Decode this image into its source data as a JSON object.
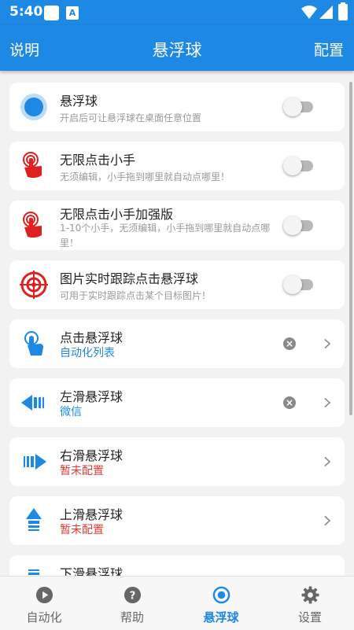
{
  "status_bar": {
    "time": "5:40",
    "a_icon_letter": "A"
  },
  "app_bar": {
    "left_label": "说明",
    "title": "悬浮球",
    "right_label": "配置"
  },
  "toggle_items": [
    {
      "title": "悬浮球",
      "subtitle": "开启后可让悬浮球在桌面任意位置",
      "icon": "floating-ball-icon",
      "enabled": false
    },
    {
      "title": "无限点击小手",
      "subtitle": "无须编辑，小手拖到哪里就自动点哪里！",
      "icon": "tap-hand-icon",
      "enabled": false
    },
    {
      "title": "无限点击小手加强版",
      "subtitle": "1-10个小手，无须编辑，小手拖到哪里就自动点哪里！",
      "icon": "multi-tap-hand-icon",
      "enabled": false
    },
    {
      "title": "图片实时跟踪点击悬浮球",
      "subtitle": "可用于实时跟踪点击某个目标图片！",
      "icon": "target-icon",
      "enabled": false
    }
  ],
  "ball_items": [
    {
      "title": "点击悬浮球",
      "value": "自动化列表",
      "state": "configured",
      "icon": "tap-icon"
    },
    {
      "title": "左滑悬浮球",
      "value": "微信",
      "state": "configured",
      "icon": "swipe-left-icon"
    },
    {
      "title": "右滑悬浮球",
      "value": "暂未配置",
      "state": "unconfigured",
      "icon": "swipe-right-icon"
    },
    {
      "title": "上滑悬浮球",
      "value": "暂未配置",
      "state": "unconfigured",
      "icon": "swipe-up-icon"
    },
    {
      "title": "下滑悬浮球",
      "icon": "swipe-down-icon"
    }
  ],
  "bottom_nav": [
    {
      "label": "自动化",
      "icon": "play-circle-icon",
      "active": false
    },
    {
      "label": "帮助",
      "icon": "help-circle-icon",
      "active": false
    },
    {
      "label": "悬浮球",
      "icon": "radio-button-icon",
      "active": true
    },
    {
      "label": "设置",
      "icon": "gear-icon",
      "active": false
    }
  ],
  "colors": {
    "primary": "#1e88e5",
    "warning": "#e53935",
    "icon_red": "#e02020"
  }
}
